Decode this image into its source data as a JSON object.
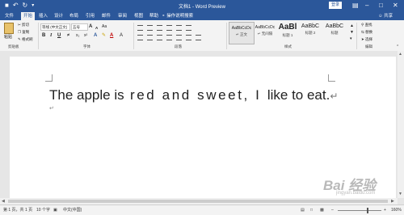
{
  "titlebar": {
    "title": "文档1 - Word Preview",
    "login": "登录",
    "save_icon": "save-icon",
    "undo_icon": "undo-icon",
    "redo_icon": "redo-icon"
  },
  "tabs": [
    "文件",
    "开始",
    "插入",
    "设计",
    "布局",
    "引用",
    "邮件",
    "审阅",
    "视图",
    "帮助"
  ],
  "active_tab": "开始",
  "tell_me": "操作说明搜索",
  "share": "共享",
  "clipboard": {
    "paste": "粘贴",
    "cut": "剪切",
    "copy": "复制",
    "format_painter": "格式刷",
    "group": "剪贴板"
  },
  "font": {
    "name": "等线 (中文正文)",
    "size": "五号",
    "grow": "A",
    "shrink": "A",
    "clear": "Aa",
    "bold": "B",
    "italic": "I",
    "underline": "U",
    "group": "字体"
  },
  "paragraph": {
    "group": "段落"
  },
  "styles": {
    "group": "样式",
    "items": [
      {
        "sample": "AaBbCcDc",
        "name": "↵ 正文"
      },
      {
        "sample": "AaBbCcDc",
        "name": "↵ 无间隔"
      },
      {
        "sample": "AaBl",
        "name": "标题 1"
      },
      {
        "sample": "AaBbC",
        "name": "标题 2"
      },
      {
        "sample": "AaBbC",
        "name": "标题"
      }
    ]
  },
  "editing": {
    "find": "查找",
    "replace": "替换",
    "select": "选择",
    "group": "编辑"
  },
  "document": {
    "text_part1": "The apple is",
    "text_part2": " red and sweet, I ",
    "text_part3": "like to eat.",
    "para_mark": "↵"
  },
  "status": {
    "page": "第 1 页，共 1 页",
    "words": "10 个字",
    "lang": "中文(中国)",
    "zoom": "160%"
  },
  "watermark": {
    "text": "Bai 经验",
    "sub": "jingyan.baidu.com"
  },
  "colors": {
    "accent": "#2b579a"
  }
}
